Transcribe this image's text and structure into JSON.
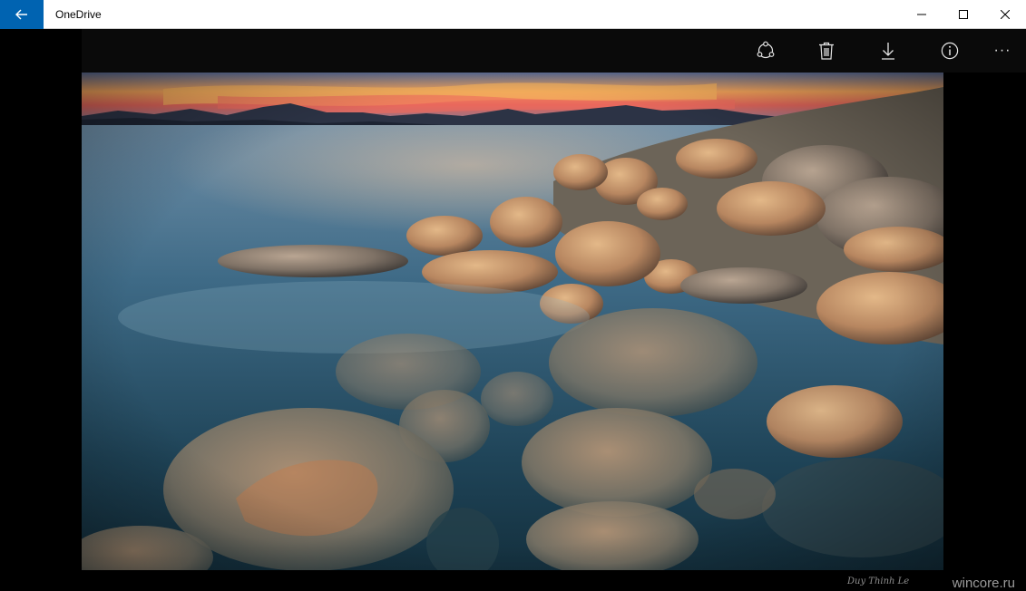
{
  "window": {
    "title": "OneDrive"
  },
  "toolbar": {
    "icons": [
      "share-icon",
      "delete-icon",
      "download-icon",
      "info-icon",
      "more-icon"
    ],
    "more_glyph": "···"
  },
  "photo": {
    "signature": "Duy Thinh Le",
    "site_watermark": "wincore.ru"
  },
  "colors": {
    "accent": "#0063b1",
    "toolbar_bg": "#0a0a0a"
  }
}
